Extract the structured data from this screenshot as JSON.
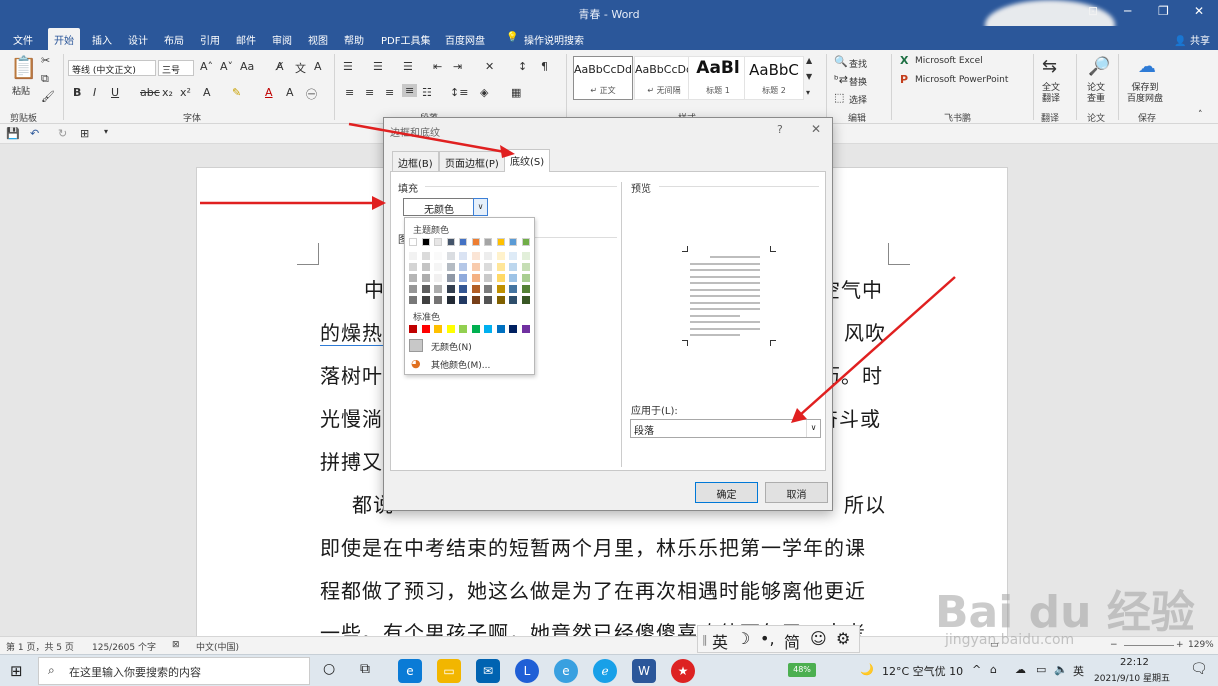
{
  "window": {
    "title": "青春 - Word",
    "minimize": "─",
    "restore": "❐",
    "close": "✕",
    "options": "⊡"
  },
  "ribbon_tabs": [
    "文件",
    "开始",
    "插入",
    "设计",
    "布局",
    "引用",
    "邮件",
    "审阅",
    "视图",
    "帮助",
    "PDF工具集",
    "百度网盘"
  ],
  "tell_me": "操作说明搜索",
  "share": "共享",
  "ribbon": {
    "clipboard": {
      "paste": "粘贴",
      "label": "剪贴板"
    },
    "font": {
      "name": "等线 (中文正文)",
      "size": "三号",
      "label": "字体"
    },
    "paragraph": {
      "label": "段落"
    },
    "styles": {
      "label": "样式",
      "items": [
        {
          "preview": "AaBbCcDd",
          "name": "↵ 正文"
        },
        {
          "preview": "AaBbCcDd",
          "name": "↵ 无间隔"
        },
        {
          "preview": "AaBl",
          "name": "标题 1"
        },
        {
          "preview": "AaBbC",
          "name": "标题 2"
        }
      ]
    },
    "editing": {
      "find": "查找",
      "replace": "替换",
      "select": "选择",
      "label": "编辑"
    },
    "feishu": {
      "excel": "Microsoft Excel",
      "ppt": "Microsoft PowerPoint",
      "label": "飞书鹏"
    },
    "translate": {
      "btn": "全文\n翻译",
      "label": "翻译"
    },
    "paper": {
      "btn": "论文\n查重",
      "label": "论文"
    },
    "save": {
      "btn": "保存到\n百度网盘",
      "label": "保存"
    }
  },
  "document": {
    "lines": [
      {
        "left": "中",
        "right": "空气中"
      },
      {
        "left": "的燥热",
        "right": "风吹"
      },
      {
        "left": "落树叶",
        "right": "历。时"
      },
      {
        "left": "光慢淌",
        "right": "奋斗或"
      },
      {
        "left": "拼搏又",
        "right": ""
      },
      {
        "left": "都说",
        "right": "所以"
      },
      {
        "left": "即使是在中考结束的短暂两个月里，林乐乐把第一学年的课",
        "right": ""
      },
      {
        "left": "程都做了预习，她这么做是为了在再次相遇时能够离他更近",
        "right": ""
      },
      {
        "left": "一些。有个男孩子啊，她竟然已经傻傻喜欢他两年了。中考",
        "right": ""
      }
    ]
  },
  "dialog": {
    "title": "边框和底纹",
    "help": "?",
    "close": "✕",
    "tabs": [
      "边框(B)",
      "页面边框(P)",
      "底纹(S)"
    ],
    "fill_label": "填充",
    "fill_value": "无颜色",
    "pattern_label": "图",
    "preview_label": "预览",
    "apply_label": "应用于(L):",
    "apply_value": "段落",
    "ok": "确定",
    "cancel": "取消",
    "palette": {
      "theme_label": "主题颜色",
      "standard_label": "标准色",
      "no_color": "无颜色(N)",
      "more_colors": "其他颜色(M)...",
      "theme_top": [
        "#ffffff",
        "#000000",
        "#e7e6e6",
        "#44546a",
        "#4472c4",
        "#ed7d31",
        "#a5a5a5",
        "#ffc000",
        "#5b9bd5",
        "#70ad47"
      ],
      "standard": [
        "#c00000",
        "#ff0000",
        "#ffc000",
        "#ffff00",
        "#92d050",
        "#00b050",
        "#00b0f0",
        "#0070c0",
        "#002060",
        "#7030a0"
      ]
    }
  },
  "status": {
    "page": "第 1 页，共 5 页",
    "words": "125/2605 个字",
    "lang": "中文(中国)",
    "zoom": "129%"
  },
  "ime": {
    "items": [
      "英",
      "☽",
      "•,",
      "简",
      "☺",
      "⚙"
    ]
  },
  "taskbar": {
    "search_placeholder": "在这里输入你要搜索的内容",
    "battery": "48%",
    "weather": "12°C 空气优 10",
    "ime_lang": "英",
    "time": "22:12",
    "date": "2021/9/10 星期五"
  },
  "watermark": {
    "text": "Bai du 经验",
    "sub": "jingyan.baidu.com"
  }
}
